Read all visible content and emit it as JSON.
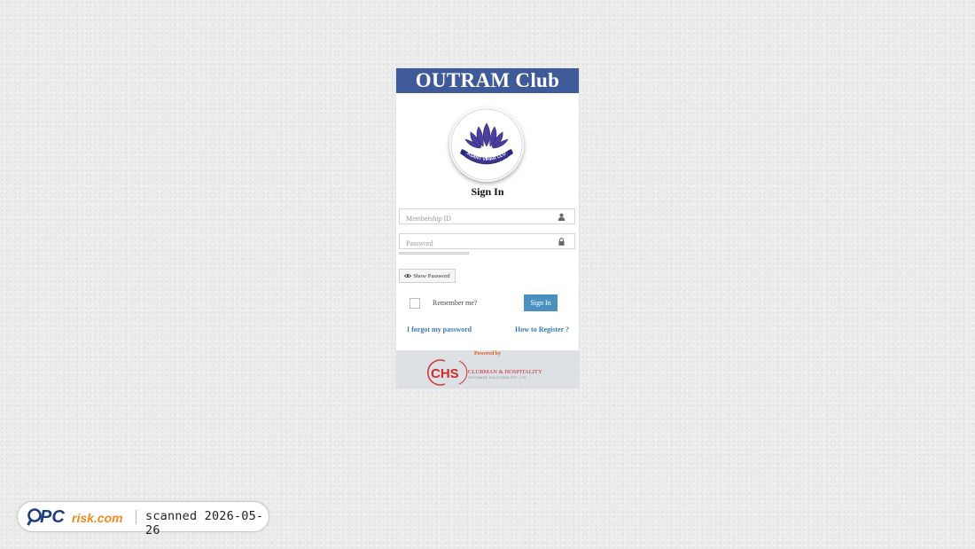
{
  "colors": {
    "header_bg": "#3f5a98",
    "accent": "#4a91c2",
    "link": "#3a7ab0",
    "powered_by": "#e55a1c",
    "chs_red": "#d42b2b"
  },
  "header": {
    "title": "OUTRAM Club"
  },
  "logo": {
    "icon": "lotus-club-emblem-icon",
    "text": "VASANT VIHAR CLUB"
  },
  "form": {
    "heading": "Sign In",
    "membership": {
      "placeholder": "Membership ID",
      "value": "",
      "icon": "user-icon"
    },
    "password": {
      "placeholder": "Password",
      "value": "",
      "icon": "lock-icon"
    },
    "show_password": {
      "label": "Show Password",
      "icon": "eye-icon"
    },
    "remember_label": "Remember me?",
    "submit_label": "Sign In",
    "forgot_label": "I forgot my password",
    "register_label": "How to Register ?"
  },
  "footer": {
    "powered_by": "Powered by",
    "vendor_logo_text": "CHS",
    "vendor_name": "CLUBMAN & HOSPITALITY",
    "vendor_sub": "SOFTWARE SOLUTIONS PVT. LTD."
  },
  "watermark": {
    "brand": "PCrisk.com",
    "scan_text": "scanned 2026-05-26"
  }
}
